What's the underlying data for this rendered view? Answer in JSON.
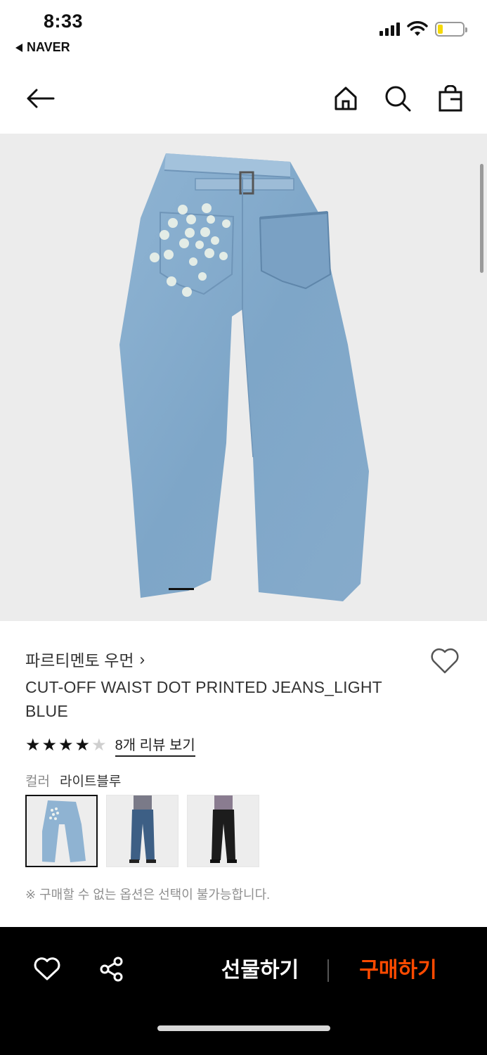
{
  "status_bar": {
    "time": "8:33",
    "back_app": "NAVER"
  },
  "nav": {
    "icons": [
      "back-arrow-icon",
      "home-icon",
      "search-icon",
      "shopping-bag-icon"
    ]
  },
  "product": {
    "brand": "파르티멘토 우먼",
    "brand_chevron": "›",
    "name": "CUT-OFF WAIST DOT PRINTED JEANS_LIGHT BLUE",
    "rating": {
      "value": 4,
      "max": 5
    },
    "review_link": "8개 리뷰 보기",
    "color_label": "컬러",
    "color_value": "라이트블루",
    "swatches": [
      "light-blue-jeans",
      "blue-jeans",
      "black-jeans"
    ],
    "selected_swatch": 0,
    "notice": "※ 구매할 수 없는 옵션은 선택이 불가능합니다."
  },
  "bottom_bar": {
    "gift_label": "선물하기",
    "buy_label": "구매하기",
    "buy_color": "#ff4a00"
  }
}
